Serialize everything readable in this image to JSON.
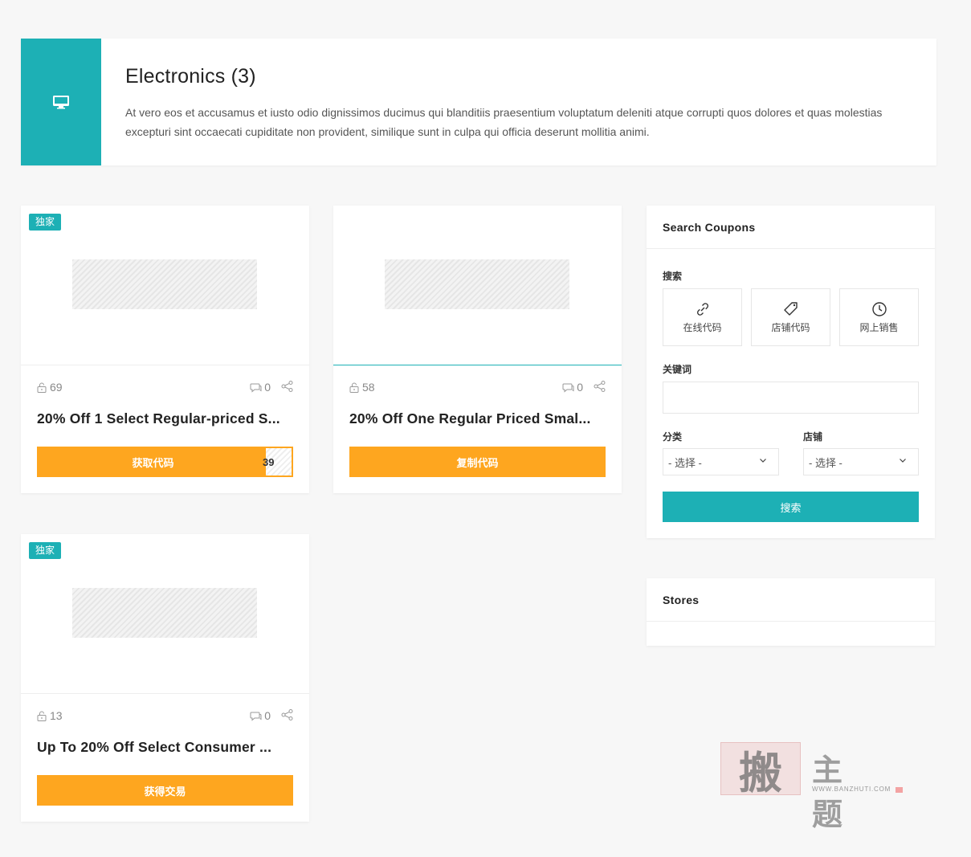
{
  "category": {
    "title": "Electronics (3)",
    "description": "At vero eos et accusamus et iusto odio dignissimos ducimus qui blanditiis praesentium voluptatum deleniti atque corrupti quos dolores et quas molestias excepturi sint occaecati cupiditate non provident, similique sunt in culpa qui officia deserunt mollitia animi.",
    "icon": "monitor-icon"
  },
  "coupons": [
    {
      "badge": "独家",
      "views": "69",
      "comments": "0",
      "title": "20% Off 1 Select Regular-priced S...",
      "button": "获取代码",
      "code_peek": "39"
    },
    {
      "badge": "",
      "views": "58",
      "comments": "0",
      "title": "20% Off One Regular Priced Smal...",
      "button": "复制代码"
    },
    {
      "badge": "独家",
      "views": "13",
      "comments": "0",
      "title": "Up To 20% Off Select Consumer ...",
      "button": "获得交易"
    }
  ],
  "search_widget": {
    "title": "Search Coupons",
    "search_label": "搜索",
    "types": [
      {
        "label": "在线代码",
        "icon": "link-icon"
      },
      {
        "label": "店铺代码",
        "icon": "tag-icon"
      },
      {
        "label": "网上销售",
        "icon": "clock-icon"
      }
    ],
    "keyword_label": "关键词",
    "keyword_value": "",
    "category_label": "分类",
    "category_value": "- 选择 -",
    "store_label": "店铺",
    "store_value": "- 选择 -",
    "button": "搜索"
  },
  "stores_widget": {
    "title": "Stores"
  },
  "watermark": {
    "seal": "搬",
    "text": "主题",
    "url": "WWW.BANZHUTI.COM"
  },
  "colors": {
    "accent": "#1db0b5",
    "button": "#fea61f",
    "background": "#f7f7f7"
  }
}
